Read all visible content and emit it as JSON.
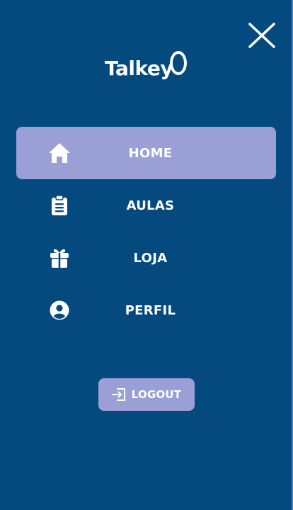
{
  "app": {
    "logo_text": "Talkey"
  },
  "menu": {
    "items": [
      {
        "label": "HOME",
        "icon": "home-icon",
        "active": true
      },
      {
        "label": "AULAS",
        "icon": "clipboard-icon",
        "active": false
      },
      {
        "label": "LOJA",
        "icon": "gift-icon",
        "active": false
      },
      {
        "label": "PERFIL",
        "icon": "user-circle-icon",
        "active": false
      }
    ]
  },
  "logout": {
    "label": "LOGOUT",
    "icon": "logout-icon"
  },
  "colors": {
    "background": "#044a7e",
    "accent": "#9a9fd6",
    "text": "#ffffff"
  }
}
